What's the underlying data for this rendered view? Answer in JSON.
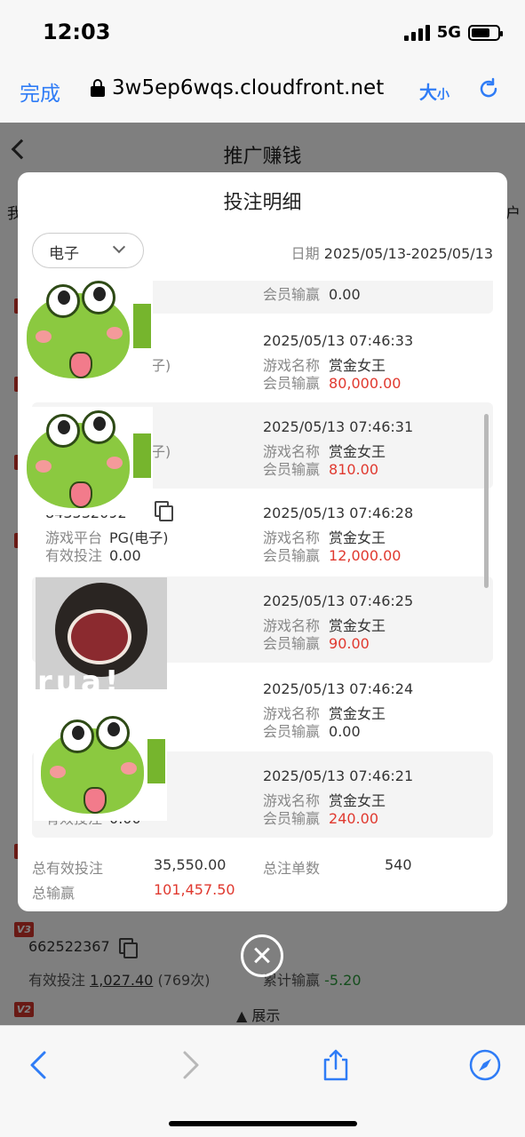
{
  "status_bar": {
    "time": "12:03",
    "network": "5G"
  },
  "browser": {
    "done_label": "完成",
    "url": "3w5ep6wqs.cloudfront.net",
    "text_size_big": "大",
    "text_size_small": "小"
  },
  "page": {
    "title": "推广赚钱",
    "left_cut_text": "我",
    "right_cut_text": "户",
    "badges": [
      "V",
      "V",
      "V",
      "V",
      "V",
      "V",
      "V",
      "V",
      "V",
      "V3",
      "V2"
    ],
    "under_member": {
      "id": "662522367",
      "valid_label": "有效投注",
      "valid_value": "1,027.40",
      "valid_count": "(769次)",
      "cum_label": "累计输赢",
      "cum_value": "-5.20",
      "expand_label": "展示"
    }
  },
  "modal": {
    "title": "投注明细",
    "filter_value": "电子",
    "date_label": "日期",
    "date_range": "2025/05/13-2025/05/13",
    "labels": {
      "game_name": "游戏名称",
      "member_win": "会员输赢",
      "platform": "游戏平台",
      "valid_bet": "有效投注"
    },
    "records": [
      {
        "time": "",
        "game": "",
        "win": "0.00",
        "win_color": "dark"
      },
      {
        "time": "2025/05/13 07:46:33",
        "game": "赏金女王",
        "win": "80,000.00",
        "win_color": "red"
      },
      {
        "time": "2025/05/13 07:46:31",
        "game": "赏金女王",
        "win": "810.00",
        "win_color": "red"
      },
      {
        "time": "2025/05/13 07:46:28",
        "game": "赏金女王",
        "win": "12,000.00",
        "win_color": "red",
        "left_id": "843532092",
        "left_platform": "PG(电子)",
        "left_valid": "0.00"
      },
      {
        "time": "2025/05/13 07:46:25",
        "game": "赏金女王",
        "win": "90.00",
        "win_color": "red"
      },
      {
        "time": "2025/05/13 07:46:24",
        "game": "赏金女王",
        "win": "0.00",
        "win_color": "dark"
      },
      {
        "time": "2025/05/13 07:46:21",
        "game": "赏金女王",
        "win": "240.00",
        "win_color": "red",
        "left_valid": "0.00"
      }
    ],
    "partial_left": {
      "r1_suffix": "子)",
      "r2_suffix": "子)"
    },
    "totals": {
      "total_valid_label": "总有效投注",
      "total_valid_value": "35,550.00",
      "total_count_label": "总注单数",
      "total_count_value": "540",
      "total_win_label": "总输赢",
      "total_win_value": "101,457.50"
    },
    "sticker_text": "rua!"
  },
  "colors": {
    "accent": "#2f7cf6",
    "loss": "#e0392f",
    "gain": "#2a9b3a"
  }
}
